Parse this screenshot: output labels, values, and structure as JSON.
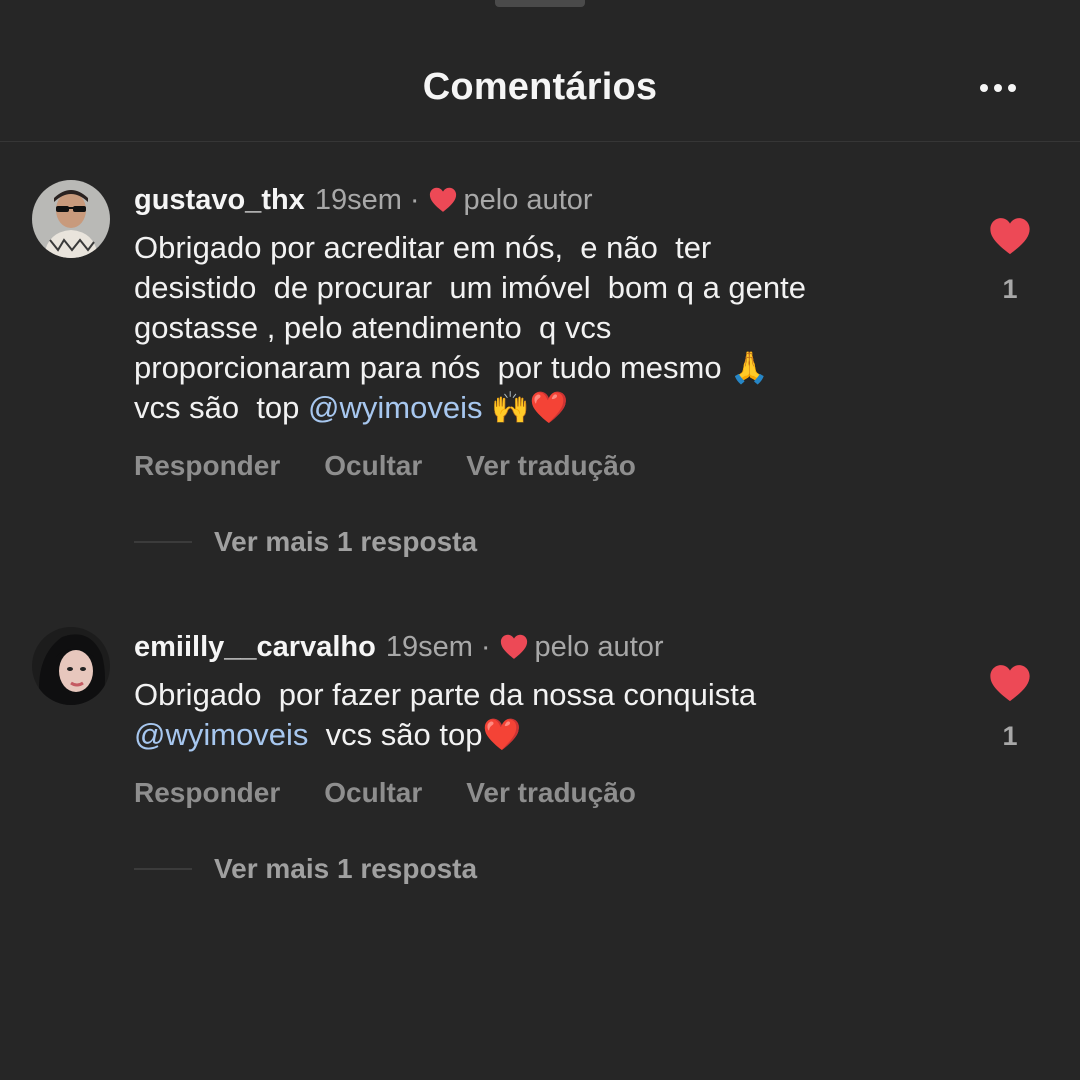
{
  "header": {
    "title": "Comentários",
    "more_icon": "more-horizontal-icon"
  },
  "colors": {
    "background": "#262626",
    "heart": "#ed4956",
    "secondary_text": "#a8a8a8",
    "mention": "#a7c7ef"
  },
  "comments": [
    {
      "username": "gustavo_thx",
      "timestamp": "19sem",
      "separator": "·",
      "author_liked_label": "pelo autor",
      "text_before_mention": "Obrigado por acreditar em nós,  e não  ter\ndesistido  de procurar  um imóvel  bom q a gente\ngostasse , pelo atendimento  q vcs\nproporcionaram para nós  por tudo mesmo 🙏\nvcs são  top ",
      "mention": "@wyimoveis",
      "text_after_mention": " 🙌❤️",
      "actions": [
        "Responder",
        "Ocultar",
        "Ver tradução"
      ],
      "like_count": "1",
      "view_replies": "Ver mais 1 resposta"
    },
    {
      "username": "emiilly__carvalho",
      "timestamp": "19sem",
      "separator": "·",
      "author_liked_label": "pelo autor",
      "text_before_mention": "Obrigado  por fazer parte da nossa conquista\n",
      "mention": "@wyimoveis",
      "text_after_mention": "  vcs são top❤️",
      "actions": [
        "Responder",
        "Ocultar",
        "Ver tradução"
      ],
      "like_count": "1",
      "view_replies": "Ver mais 1 resposta"
    }
  ]
}
